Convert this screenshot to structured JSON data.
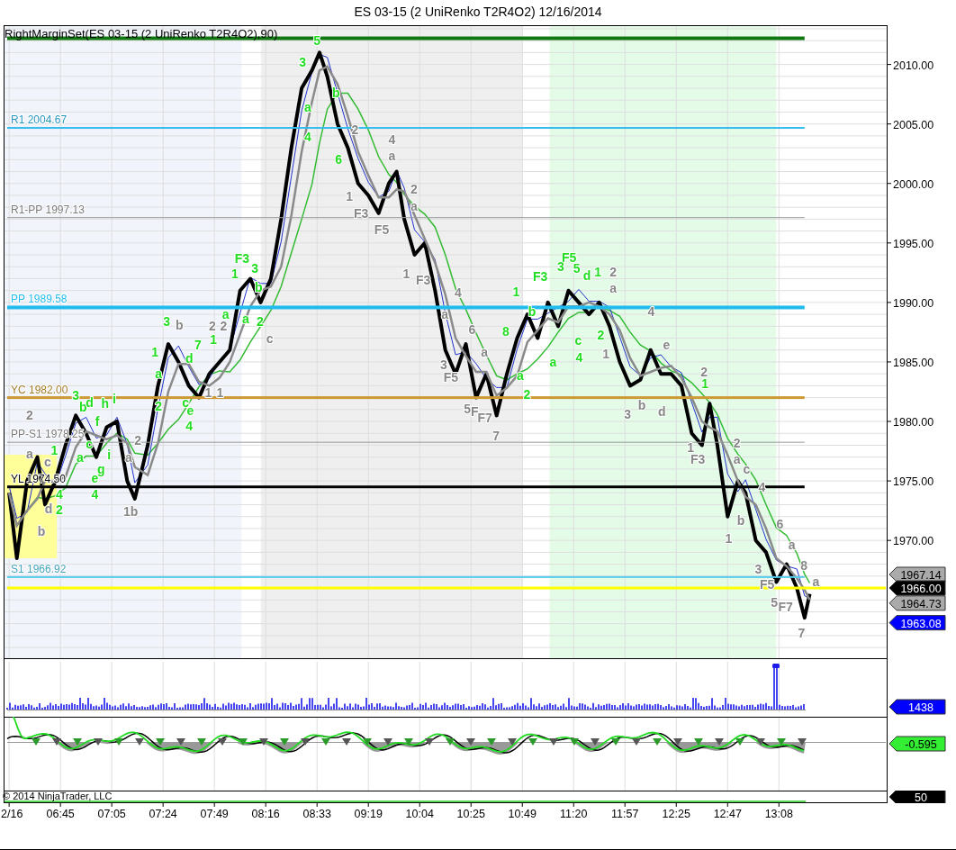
{
  "window": {
    "title": "ES 03-15 (2 UniRenko T2R4O2)  12/16/2014"
  },
  "price_panel": {
    "caption": "RightMarginSet(ES 03-15 (2 UniRenko T2R4O2),90)",
    "levels": [
      {
        "color": "#117711",
        "kind": "heavy",
        "to_axis": false
      },
      {
        "label": "R1 2004.67",
        "color": "#33bbee",
        "kind": "medium",
        "to_axis": false
      },
      {
        "label": "R1-PP 1997.13",
        "color": "#999999",
        "kind": "thin",
        "to_axis": false
      },
      {
        "label": "PP 1989.58",
        "color": "#22bbee",
        "kind": "heavy",
        "to_axis": false
      },
      {
        "label": "YC 1982.00",
        "color": "#cc9933",
        "kind": "thick",
        "to_axis": false
      },
      {
        "label": "PP-S1 1978.25",
        "color": "#999999",
        "kind": "thin",
        "to_axis": false
      },
      {
        "label": "YL 1974.50",
        "color": "#000000",
        "kind": "thick",
        "to_axis": false
      },
      {
        "label": "S1 1966.92",
        "color": "#55ccee",
        "kind": "medium",
        "to_axis": false
      },
      {
        "color": "#ffff00",
        "kind": "thick",
        "to_axis": true
      }
    ],
    "wave_labels": [
      {
        "text": "5",
        "color": "#22dd22"
      },
      {
        "text": "3",
        "color": "#22dd22"
      },
      {
        "text": "b",
        "color": "#22dd22"
      },
      {
        "text": "a",
        "color": "#22dd22"
      },
      {
        "text": "2",
        "color": "#888888"
      },
      {
        "text": "4",
        "color": "#22dd22"
      },
      {
        "text": "4",
        "color": "#888888"
      },
      {
        "text": "6",
        "color": "#22dd22"
      },
      {
        "text": "a",
        "color": "#888888"
      },
      {
        "text": "2",
        "color": "#888888"
      },
      {
        "text": "1",
        "color": "#888888"
      },
      {
        "text": "a",
        "color": "#888888"
      },
      {
        "text": "F3",
        "color": "#888888"
      },
      {
        "text": "F5",
        "color": "#888888"
      },
      {
        "text": "F3",
        "color": "#22dd22"
      },
      {
        "text": "F5",
        "color": "#22dd22"
      },
      {
        "text": "1",
        "color": "#22dd22"
      },
      {
        "text": "3",
        "color": "#22dd22"
      },
      {
        "text": "1",
        "color": "#888888"
      },
      {
        "text": "F3",
        "color": "#22dd22"
      },
      {
        "text": "3",
        "color": "#22dd22"
      },
      {
        "text": "5",
        "color": "#22dd22"
      },
      {
        "text": "d",
        "color": "#22dd22"
      },
      {
        "text": "1",
        "color": "#22dd22"
      },
      {
        "text": "2",
        "color": "#888888"
      },
      {
        "text": "b",
        "color": "#22dd22"
      },
      {
        "text": "F3",
        "color": "#888888"
      },
      {
        "text": "4",
        "color": "#888888"
      },
      {
        "text": "1",
        "color": "#22dd22"
      },
      {
        "text": "a",
        "color": "#888888"
      },
      {
        "text": "a",
        "color": "#22dd22"
      },
      {
        "text": "a",
        "color": "#22dd22"
      },
      {
        "text": "a",
        "color": "#888888"
      },
      {
        "text": "b",
        "color": "#22dd22"
      },
      {
        "text": "4",
        "color": "#888888"
      },
      {
        "text": "3",
        "color": "#22dd22"
      },
      {
        "text": "b",
        "color": "#888888"
      },
      {
        "text": "2",
        "color": "#888888"
      },
      {
        "text": "2",
        "color": "#888888"
      },
      {
        "text": "2",
        "color": "#22dd22"
      },
      {
        "text": "c",
        "color": "#888888"
      },
      {
        "text": "6",
        "color": "#888888"
      },
      {
        "text": "8",
        "color": "#22dd22"
      },
      {
        "text": "2",
        "color": "#22dd22"
      },
      {
        "text": "7",
        "color": "#22dd22"
      },
      {
        "text": "1",
        "color": "#22dd22"
      },
      {
        "text": "c",
        "color": "#22dd22"
      },
      {
        "text": "e",
        "color": "#888888"
      },
      {
        "text": "1",
        "color": "#22dd22"
      },
      {
        "text": "d",
        "color": "#22dd22"
      },
      {
        "text": "a",
        "color": "#888888"
      },
      {
        "text": "a",
        "color": "#22dd22"
      },
      {
        "text": "4",
        "color": "#22dd22"
      },
      {
        "text": "1",
        "color": "#888888"
      },
      {
        "text": "a",
        "color": "#22dd22"
      },
      {
        "text": "3",
        "color": "#888888"
      },
      {
        "text": "F5",
        "color": "#888888"
      },
      {
        "text": "a",
        "color": "#22dd22"
      },
      {
        "text": "2",
        "color": "#888888"
      },
      {
        "text": "1",
        "color": "#22dd22"
      },
      {
        "text": "3",
        "color": "#22dd22"
      },
      {
        "text": "b",
        "color": "#22dd22"
      },
      {
        "text": "d",
        "color": "#22dd22"
      },
      {
        "text": "h",
        "color": "#22dd22"
      },
      {
        "text": "i",
        "color": "#22dd22"
      },
      {
        "text": "2",
        "color": "#22dd22"
      },
      {
        "text": "c",
        "color": "#22dd22"
      },
      {
        "text": "1",
        "color": "#888888"
      },
      {
        "text": "1",
        "color": "#888888"
      },
      {
        "text": "2",
        "color": "#22dd22"
      },
      {
        "text": "2",
        "color": "#888888"
      },
      {
        "text": "f",
        "color": "#22dd22"
      },
      {
        "text": "e",
        "color": "#22dd22"
      },
      {
        "text": "5",
        "color": "#888888"
      },
      {
        "text": "F",
        "color": "#888888"
      },
      {
        "text": "F7",
        "color": "#888888"
      },
      {
        "text": "3",
        "color": "#888888"
      },
      {
        "text": "b",
        "color": "#888888"
      },
      {
        "text": "d",
        "color": "#888888"
      },
      {
        "text": "4",
        "color": "#22dd22"
      },
      {
        "text": "c",
        "color": "#22dd22"
      },
      {
        "text": "2",
        "color": "#888888"
      },
      {
        "text": "7",
        "color": "#888888"
      },
      {
        "text": "2",
        "color": "#888888"
      },
      {
        "text": "a",
        "color": "#888888"
      },
      {
        "text": "1",
        "color": "#22dd22"
      },
      {
        "text": "a",
        "color": "#22dd22"
      },
      {
        "text": "i",
        "color": "#22dd22"
      },
      {
        "text": "a",
        "color": "#888888"
      },
      {
        "text": "1",
        "color": "#888888"
      },
      {
        "text": "c",
        "color": "#888888"
      },
      {
        "text": "g",
        "color": "#22dd22"
      },
      {
        "text": "F3",
        "color": "#888888"
      },
      {
        "text": "a",
        "color": "#888888"
      },
      {
        "text": "c",
        "color": "#888888"
      },
      {
        "text": "e",
        "color": "#22dd22"
      },
      {
        "text": "4",
        "color": "#888888"
      },
      {
        "text": "4",
        "color": "#22dd22"
      },
      {
        "text": "4",
        "color": "#22dd22"
      },
      {
        "text": "d",
        "color": "#888888"
      },
      {
        "text": "2",
        "color": "#22dd22"
      },
      {
        "text": "1b",
        "color": "#888888"
      },
      {
        "text": "b",
        "color": "#888888"
      },
      {
        "text": "6",
        "color": "#888888"
      },
      {
        "text": "b",
        "color": "#888888"
      },
      {
        "text": "1",
        "color": "#888888"
      },
      {
        "text": "a",
        "color": "#888888"
      },
      {
        "text": "3",
        "color": "#888888"
      },
      {
        "text": "8",
        "color": "#888888"
      },
      {
        "text": "F5",
        "color": "#888888"
      },
      {
        "text": "a",
        "color": "#888888"
      },
      {
        "text": "5",
        "color": "#888888"
      },
      {
        "text": "F7",
        "color": "#888888"
      },
      {
        "text": "7",
        "color": "#888888"
      }
    ],
    "price_axis": [
      "2010.00",
      "2005.00",
      "2000.00",
      "1995.00",
      "1990.00",
      "1985.00",
      "1980.00",
      "1975.00",
      "1970.00"
    ],
    "price_tags": [
      {
        "label": "1967.14",
        "color": "#aaaaaa"
      },
      {
        "label": "1966.00",
        "color": "#000000"
      },
      {
        "label": "1964.73",
        "color": "#aaaaaa"
      },
      {
        "label": "1963.08",
        "color": "#0000ff"
      }
    ]
  },
  "volume_panel": {
    "marker": {
      "label": "1438",
      "color": "#0000ff"
    }
  },
  "oscillator_panel": {
    "marker": {
      "label": "-0.595",
      "color": "#33ee33"
    }
  },
  "footer_panel": {
    "copyright": "© 2014 NinjaTrader, LLC",
    "marker": {
      "label": "50",
      "color": "#000000"
    }
  },
  "time_axis": [
    "2/16",
    "06:45",
    "07:05",
    "07:24",
    "07:49",
    "08:16",
    "08:33",
    "09:19",
    "10:04",
    "10:25",
    "10:49",
    "11:20",
    "11:57",
    "12:25",
    "12:47",
    "13:08"
  ]
}
